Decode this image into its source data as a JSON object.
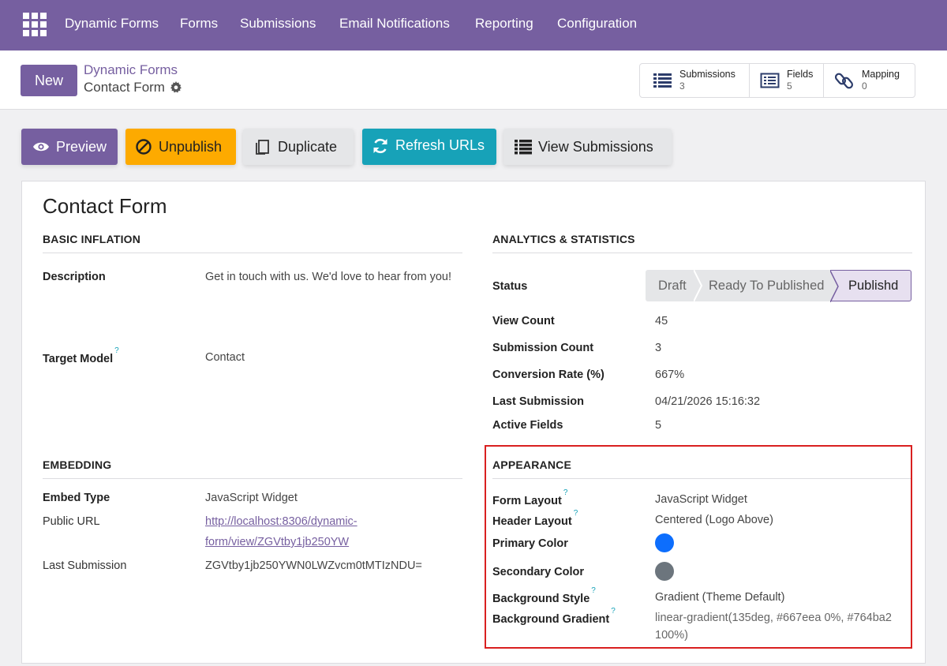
{
  "nav": {
    "items": [
      "Dynamic Forms",
      "Forms",
      "Submissions",
      "Email Notifications",
      "Reporting",
      "Configuration"
    ]
  },
  "control": {
    "new_label": "New",
    "breadcrumb_parent": "Dynamic Forms",
    "breadcrumb_current": "Contact Form"
  },
  "smart_buttons": [
    {
      "label": "Submissions",
      "count": "3",
      "icon": "list-icon"
    },
    {
      "label": "Fields",
      "count": "5",
      "icon": "list-alt-icon"
    },
    {
      "label": "Mapping",
      "count": "0",
      "icon": "link-icon"
    }
  ],
  "actions": {
    "preview": "Preview",
    "unpublish": "Unpublish",
    "duplicate": "Duplicate",
    "refresh": "Refresh URLs",
    "view_submissions": "View Submissions"
  },
  "form": {
    "title": "Contact Form",
    "basic": {
      "heading": "BASIC INFLATION",
      "description_label": "Description",
      "description_value": "Get in touch with us. We'd love to hear from you!",
      "target_model_label": "Target Model",
      "target_model_help": "?",
      "target_model_value": "Contact"
    },
    "embedding": {
      "heading": "EMBEDDING",
      "embed_type_label": "Embed Type",
      "embed_type_value": "JavaScript Widget",
      "public_url_label": "Public URL",
      "public_url_line1": "http://localhost:8306/dynamic-",
      "public_url_line2": "form/view/ZGVtby1jb250YW",
      "last_submission_label": "Last Submission",
      "last_submission_value": "ZGVtby1jb250YWN0LWZvcm0tMTIzNDU="
    },
    "analytics": {
      "heading": "ANALYTICS & STATISTICS",
      "status_label": "Status",
      "stages": [
        "Draft",
        "Ready To Published",
        "Publishd"
      ],
      "active_stage": "Publishd",
      "view_count_label": "View Count",
      "view_count_value": "45",
      "submission_count_label": "Submission Count",
      "submission_count_value": "3",
      "conversion_label": "Conversion Rate (%)",
      "conversion_value": "667%",
      "last_submission_label": "Last Submission",
      "last_submission_value": "04/21/2026 15:16:32",
      "active_fields_label": "Active Fields",
      "active_fields_value": "5"
    },
    "appearance": {
      "heading": "APPEARANCE",
      "form_layout_label": "Form Layout",
      "form_layout_value": "JavaScript Widget",
      "header_layout_label": "Header Layout",
      "header_layout_value": "Centered (Logo Above)",
      "primary_color_label": "Primary Color",
      "primary_color": "#0d6efd",
      "secondary_color_label": "Secondary Color",
      "secondary_color": "#6c757d",
      "bg_style_label": "Background Style",
      "bg_style_value": "Gradient (Theme Default)",
      "bg_gradient_label": "Background Gradient",
      "bg_gradient_line1": "linear-gradient(135deg, #667eea 0%, #764ba2",
      "bg_gradient_line2": "100%)",
      "help_mark": "?"
    }
  },
  "colors": {
    "brand": "#765fa0",
    "warning": "#fdaa00",
    "info": "#17a2b8",
    "highlight_border": "#d92020"
  }
}
